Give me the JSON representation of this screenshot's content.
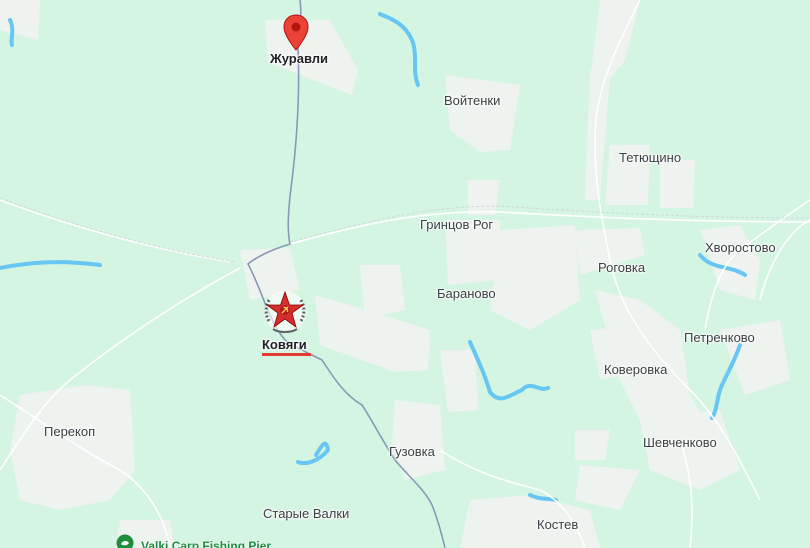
{
  "map": {
    "places": [
      {
        "id": "zhuravli",
        "name": "Журавли",
        "bold": true
      },
      {
        "id": "voytenki",
        "name": "Войтенки"
      },
      {
        "id": "tetyushchino",
        "name": "Тетющино"
      },
      {
        "id": "grintsov-rog",
        "name": "Гринцов Рог"
      },
      {
        "id": "khvorostovo",
        "name": "Хворостово"
      },
      {
        "id": "rogovka",
        "name": "Роговка"
      },
      {
        "id": "baranovo",
        "name": "Бараново"
      },
      {
        "id": "kovyagi",
        "name": "Ковяги",
        "bold": true
      },
      {
        "id": "petrenkovo",
        "name": "Петренково"
      },
      {
        "id": "koverovka",
        "name": "Коверовка"
      },
      {
        "id": "perekop",
        "name": "Перекоп"
      },
      {
        "id": "guzovka",
        "name": "Гузовка"
      },
      {
        "id": "shevchenkovo",
        "name": "Шевченково"
      },
      {
        "id": "starye-valki",
        "name": "Старые Валки"
      },
      {
        "id": "kostev",
        "name": "Костев"
      }
    ],
    "poi": {
      "name": "Valki Carp Fishing Pier"
    },
    "colors": {
      "land": "#d4f5e2",
      "fields": "#eef3f0",
      "water": "#67c6f2",
      "road": "#8a98b5",
      "pin": "#ea4335",
      "emblem_star": "#d32f2f",
      "underline": "#e53935"
    },
    "icons": {
      "pin": "map-pin-icon",
      "emblem": "soviet-star-emblem-icon",
      "poi": "fishing-poi-icon"
    }
  }
}
